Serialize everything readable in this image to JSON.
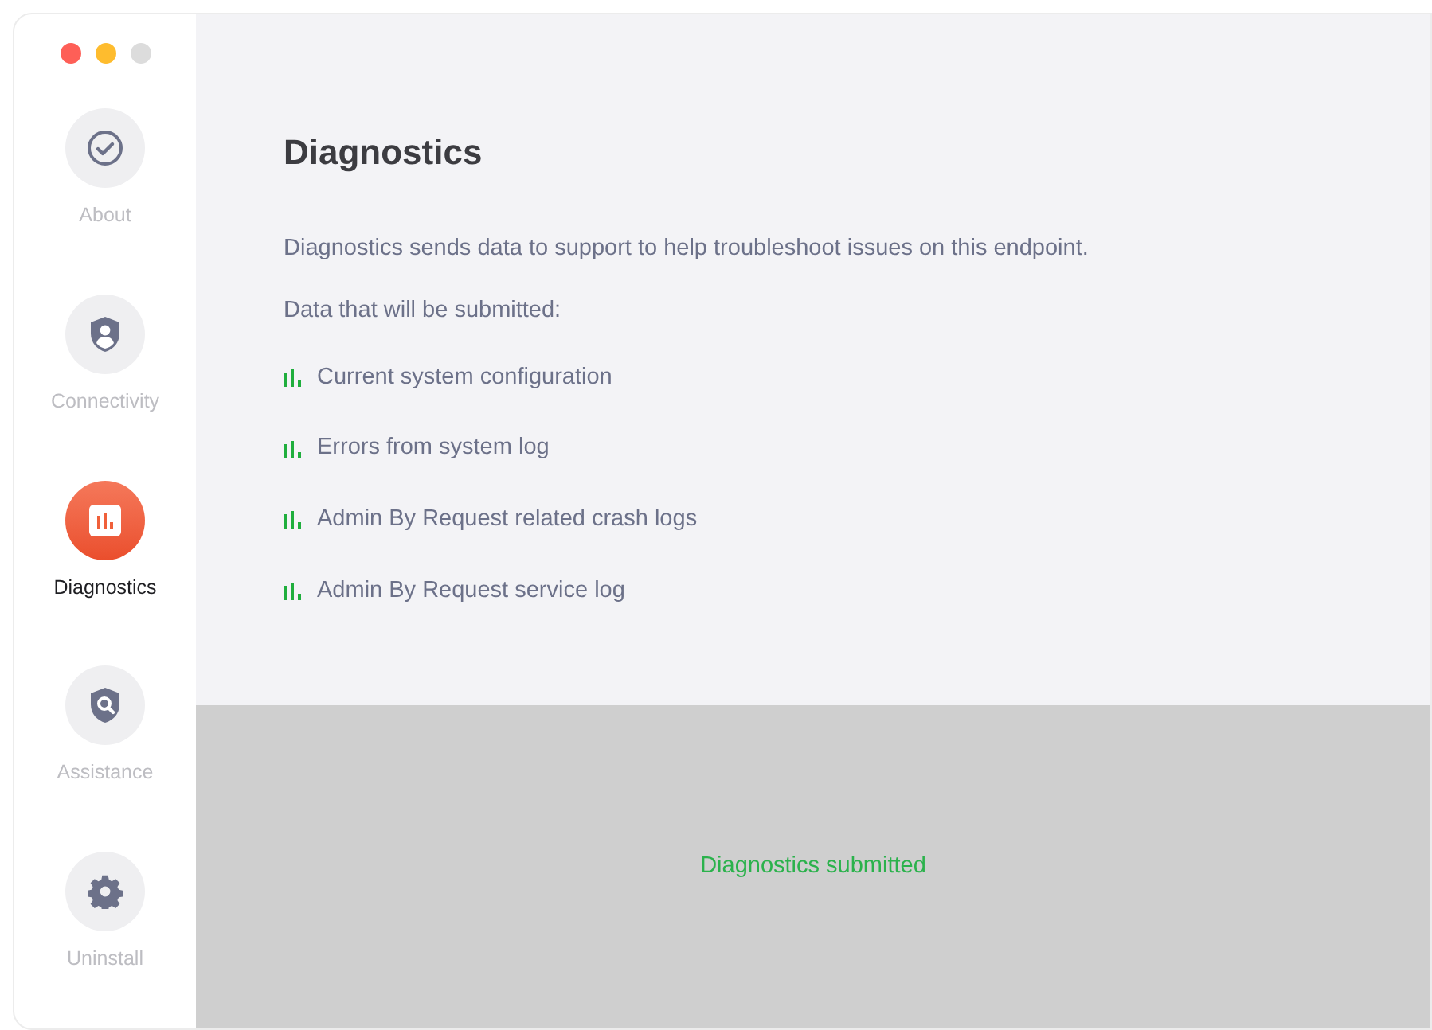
{
  "sidebar": {
    "items": [
      {
        "kind": "check",
        "label": "About",
        "selected": false
      },
      {
        "kind": "shield-user",
        "label": "Connectivity",
        "selected": false
      },
      {
        "kind": "chart",
        "label": "Diagnostics",
        "selected": true
      },
      {
        "kind": "shield-search",
        "label": "Assistance",
        "selected": false
      },
      {
        "kind": "gear",
        "label": "Uninstall",
        "selected": false
      }
    ]
  },
  "main": {
    "title": "Diagnostics",
    "description": "Diagnostics sends data to support to help troubleshoot issues on this endpoint.",
    "list_heading": "Data that will be submitted:",
    "items": [
      "Current system configuration",
      "Errors from system log",
      "Admin By Request related crash logs",
      "Admin By Request service log"
    ]
  },
  "footer": {
    "status": "Diagnostics submitted"
  }
}
